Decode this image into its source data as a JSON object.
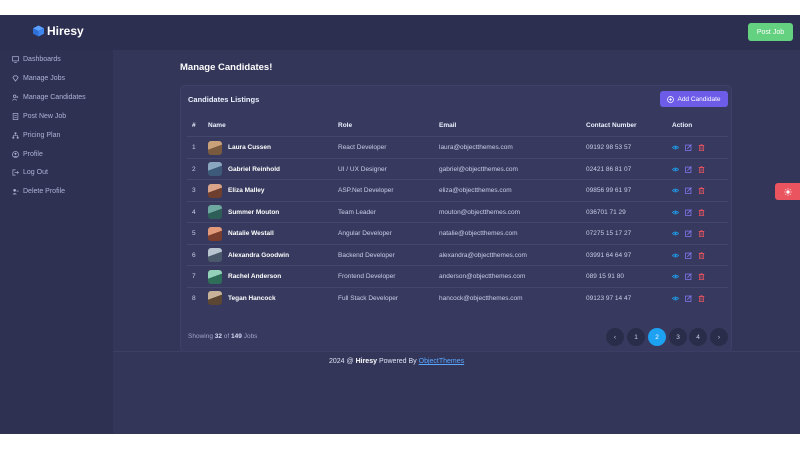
{
  "app": {
    "brand": "Hiresy",
    "post_job": "Post Job"
  },
  "sidebar": {
    "items": [
      {
        "label": "Dashboards",
        "icon": "monitor-icon"
      },
      {
        "label": "Manage Jobs",
        "icon": "diamond-icon"
      },
      {
        "label": "Manage Candidates",
        "icon": "users-icon"
      },
      {
        "label": "Post New Job",
        "icon": "document-icon"
      },
      {
        "label": "Pricing Plan",
        "icon": "sitemap-icon"
      },
      {
        "label": "Profile",
        "icon": "user-circle-icon"
      },
      {
        "label": "Log Out",
        "icon": "logout-icon"
      },
      {
        "label": "Delete Profile",
        "icon": "user-minus-icon"
      }
    ]
  },
  "main": {
    "title": "Manage Candidates!",
    "card_title": "Candidates Listings",
    "add_label": "Add Candidate",
    "columns": [
      "#",
      "Name",
      "Role",
      "Email",
      "Contact Number",
      "Action"
    ],
    "rows": [
      {
        "num": "1",
        "name": "Laura Cussen",
        "role": "React Developer",
        "email": "laura@objectthemes.com",
        "phone": "09192 98 53 57"
      },
      {
        "num": "2",
        "name": "Gabriel Reinhold",
        "role": "UI / UX Designer",
        "email": "gabriel@objectthemes.com",
        "phone": "02421 86 81 07"
      },
      {
        "num": "3",
        "name": "Eliza Malley",
        "role": "ASP.Net Developer",
        "email": "eliza@objectthemes.com",
        "phone": "09856 99 61 97"
      },
      {
        "num": "4",
        "name": "Summer Mouton",
        "role": "Team Leader",
        "email": "mouton@objectthemes.com",
        "phone": "036701 71 29"
      },
      {
        "num": "5",
        "name": "Natalie Westall",
        "role": "Angular Developer",
        "email": "natalie@objectthemes.com",
        "phone": "07275 15 17 27"
      },
      {
        "num": "6",
        "name": "Alexandra Goodwin",
        "role": "Backend Developer",
        "email": "alexandra@objectthemes.com",
        "phone": "03991 64 64 97"
      },
      {
        "num": "7",
        "name": "Rachel Anderson",
        "role": "Frontend Developer",
        "email": "anderson@objectthemes.com",
        "phone": "089 15 91 80"
      },
      {
        "num": "8",
        "name": "Tegan Hancock",
        "role": "Full Stack Developer",
        "email": "hancock@objectthemes.com",
        "phone": "09123 97 14 47"
      }
    ],
    "showing": {
      "prefix": "Showing",
      "count": "32",
      "of": "of",
      "total": "149",
      "suffix": "Jobs"
    },
    "pagination": {
      "prev": "‹",
      "pages": [
        "1",
        "2",
        "3",
        "4"
      ],
      "current": "2",
      "next": "›"
    }
  },
  "footer": {
    "year": "2024 @",
    "brand": "Hiresy",
    "powered": "Powered By",
    "link": "ObjectThemes"
  },
  "colors": {
    "accent": "#6c5ce7",
    "post_job": "#63d17f",
    "page_active": "#1da1f2",
    "delete": "#e9545e",
    "view": "#1da1f2"
  }
}
